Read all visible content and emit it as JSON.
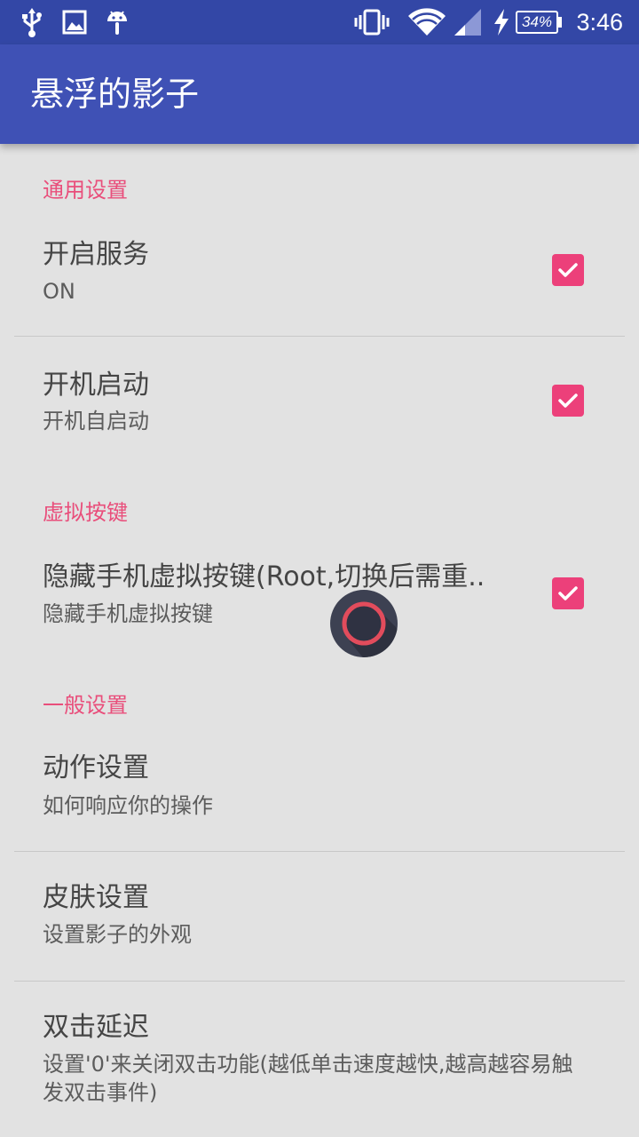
{
  "status_bar": {
    "icons_left": [
      "usb-icon",
      "image-icon",
      "android-icon"
    ],
    "icons_right": [
      "vibrate-icon",
      "wifi-icon",
      "cell-signal-icon",
      "charging-icon"
    ],
    "battery_percent": "34%",
    "time": "3:46"
  },
  "app_bar": {
    "title": "悬浮的影子"
  },
  "colors": {
    "status_bar": "#3347a6",
    "app_bar": "#3f51b5",
    "accent": "#ec407a",
    "category_text": "#e94e7b",
    "background": "#e2e2e2"
  },
  "categories": [
    {
      "label": "通用设置",
      "items": [
        {
          "title": "开启服务",
          "summary": "ON",
          "checked": true
        },
        {
          "title": "开机启动",
          "summary": "开机自启动",
          "checked": true
        }
      ]
    },
    {
      "label": "虚拟按键",
      "items": [
        {
          "title": "隐藏手机虚拟按键(Root,切换后需重..",
          "summary": "隐藏手机虚拟按键",
          "checked": true
        }
      ]
    },
    {
      "label": "一般设置",
      "items": [
        {
          "title": "动作设置",
          "summary": "如何响应你的操作"
        },
        {
          "title": "皮肤设置",
          "summary": "设置影子的外观"
        },
        {
          "title": "双击延迟",
          "summary": "设置'0'来关闭双击功能(越低单击速度越快,越高越容易触发双击事件)"
        }
      ]
    }
  ],
  "floating_ball": {
    "icon": "floating-ball-icon"
  }
}
